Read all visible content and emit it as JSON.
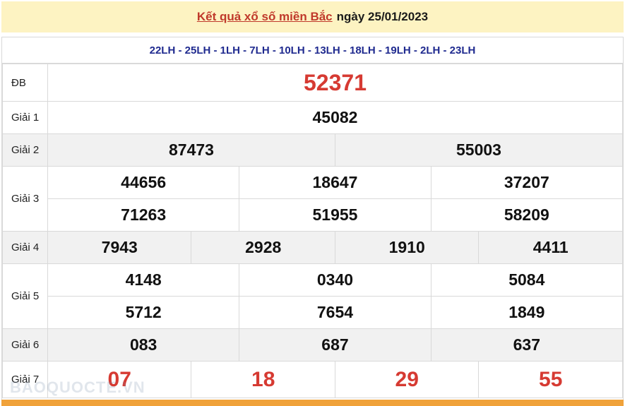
{
  "header": {
    "link_text": "Kết quả xổ số miền Bắc",
    "date_text": "ngày 25/01/2023"
  },
  "codes": "22LH - 25LH - 1LH - 7LH - 10LH - 13LH - 18LH - 19LH - 2LH - 23LH",
  "prizes": {
    "db": {
      "label": "ĐB",
      "value": "52371"
    },
    "g1": {
      "label": "Giải 1",
      "value": "45082"
    },
    "g2": {
      "label": "Giải 2",
      "values": [
        "87473",
        "55003"
      ]
    },
    "g3": {
      "label": "Giải 3",
      "values": [
        "44656",
        "18647",
        "37207",
        "71263",
        "51955",
        "58209"
      ]
    },
    "g4": {
      "label": "Giải 4",
      "values": [
        "7943",
        "2928",
        "1910",
        "4411"
      ]
    },
    "g5": {
      "label": "Giải 5",
      "values": [
        "4148",
        "0340",
        "5084",
        "5712",
        "7654",
        "1849"
      ]
    },
    "g6": {
      "label": "Giải 6",
      "values": [
        "083",
        "687",
        "637"
      ]
    },
    "g7": {
      "label": "Giải 7",
      "values": [
        "07",
        "18",
        "29",
        "55"
      ]
    }
  },
  "watermark": "BAOQUOCTE.VN",
  "colors": {
    "accent": "#d63a32",
    "header_bg": "#fdf3c2",
    "codes_text": "#1f2a8f",
    "bar": "#f0a23a"
  }
}
